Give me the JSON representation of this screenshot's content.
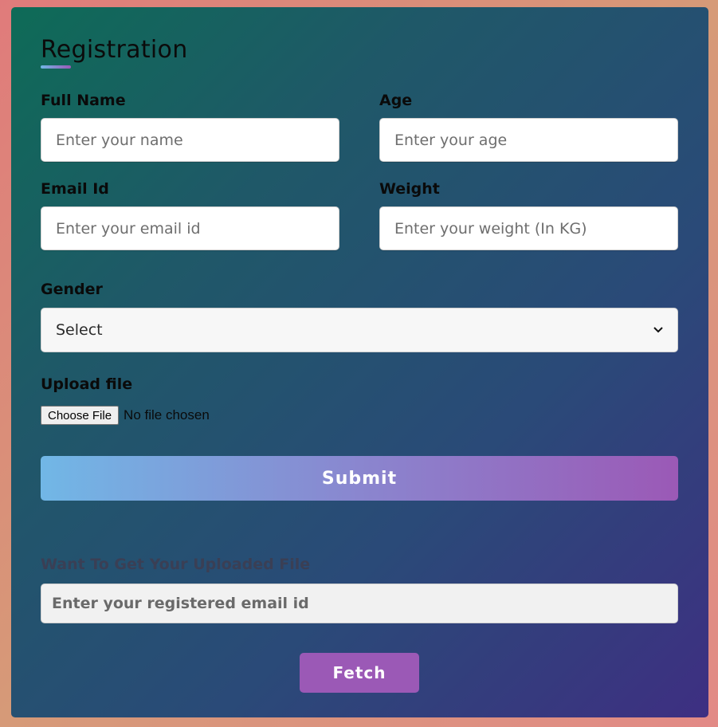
{
  "form": {
    "title": "Registration",
    "full_name": {
      "label": "Full Name",
      "placeholder": "Enter your name"
    },
    "age": {
      "label": "Age",
      "placeholder": "Enter your age"
    },
    "email": {
      "label": "Email Id",
      "placeholder": "Enter your email id"
    },
    "weight": {
      "label": "Weight",
      "placeholder": "Enter your weight (In KG)"
    },
    "gender": {
      "label": "Gender",
      "selected": "Select"
    },
    "upload": {
      "label": "Upload file",
      "button_label": "Choose File",
      "status": "No file chosen"
    },
    "submit_label": "Submit"
  },
  "fetch": {
    "heading": "Want To Get Your Uploaded File",
    "placeholder": "Enter your registered email id",
    "button_label": "Fetch"
  },
  "colors": {
    "accent_start": "#71b7e6",
    "accent_end": "#9b59b6",
    "card_gradient_start": "#0e6b57",
    "card_gradient_end": "#3e2f82"
  }
}
